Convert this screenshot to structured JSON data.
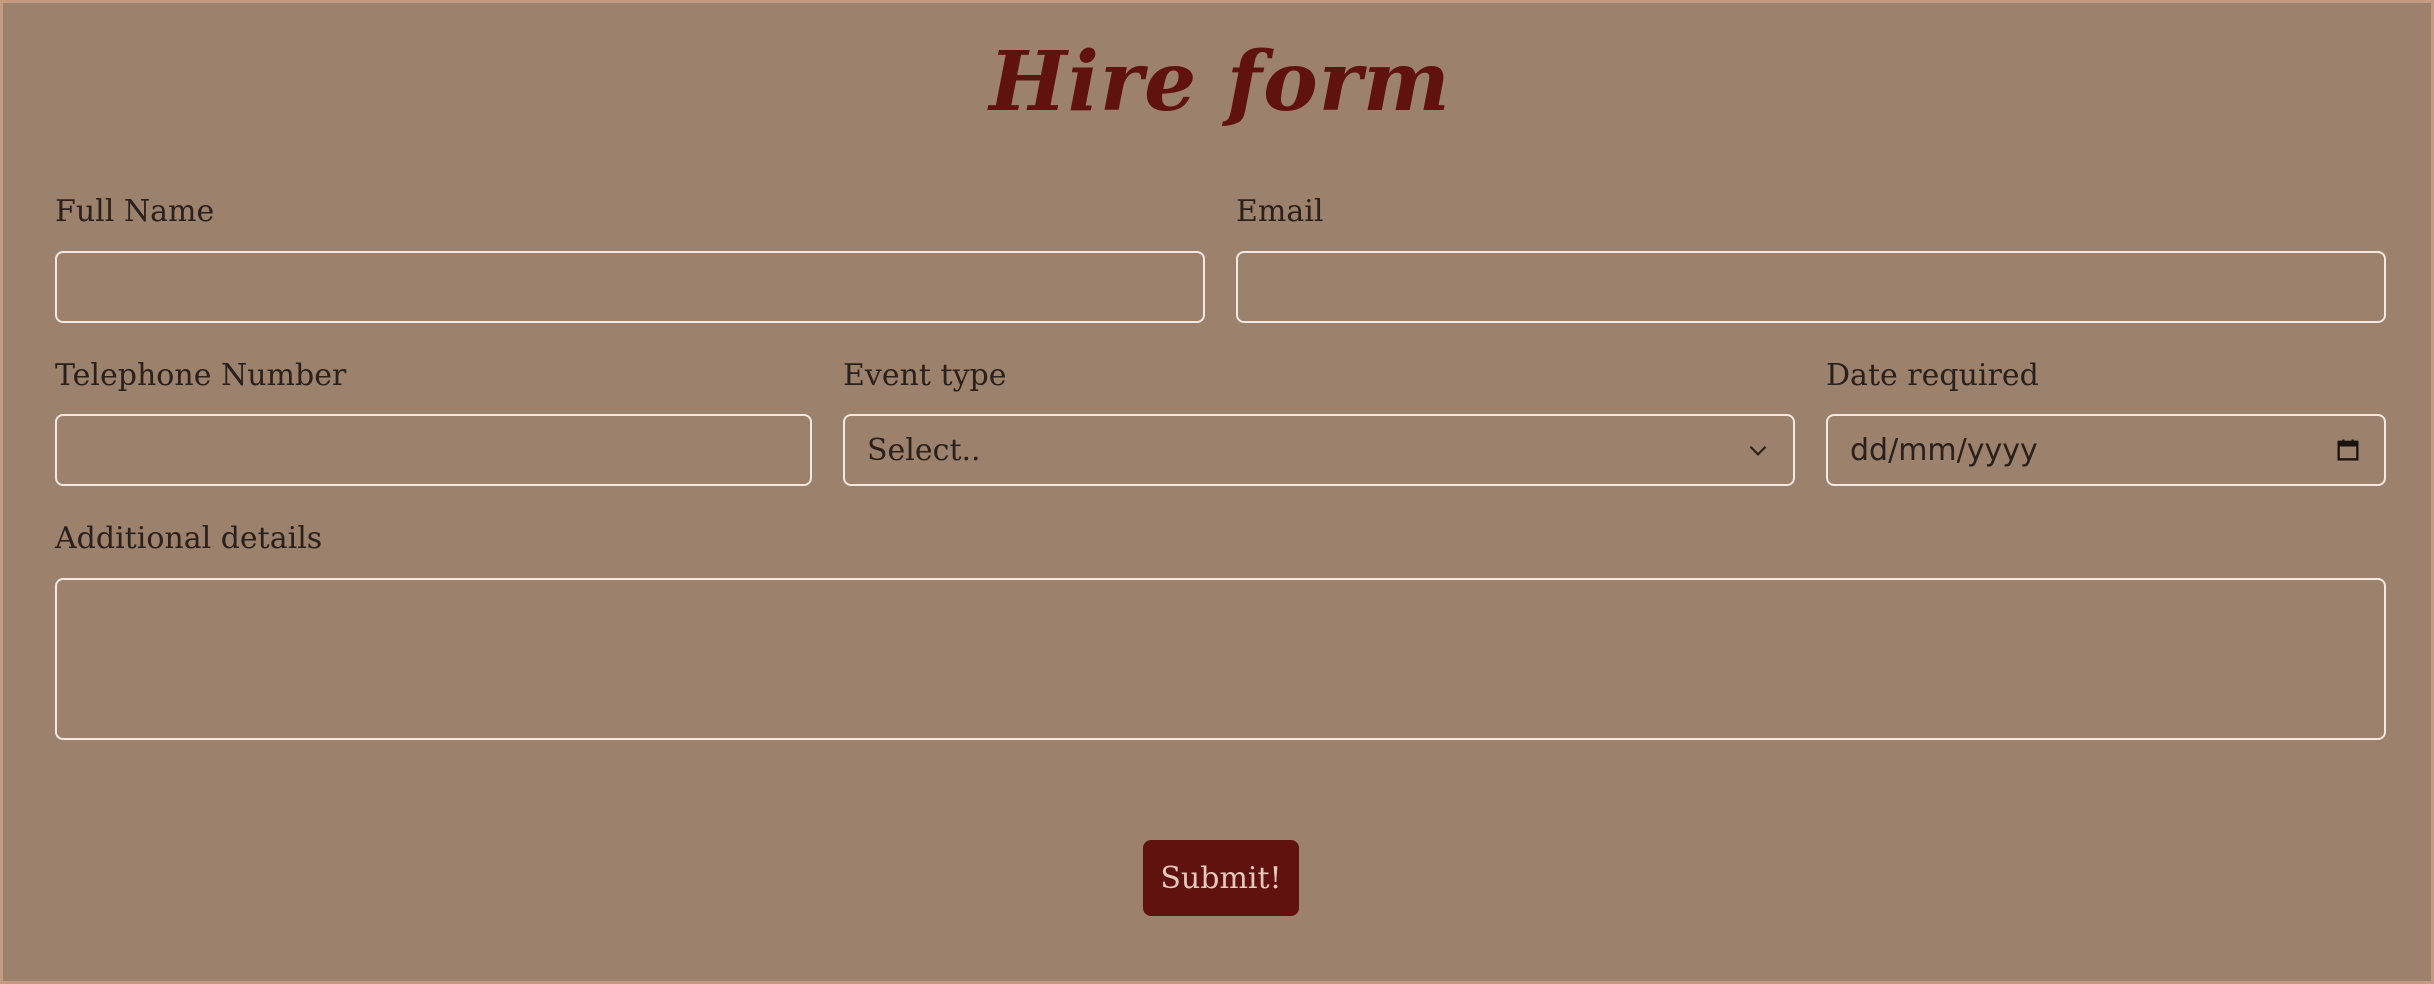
{
  "form": {
    "title": "Hire form",
    "full_name": {
      "label": "Full Name",
      "value": ""
    },
    "email": {
      "label": "Email",
      "value": ""
    },
    "telephone": {
      "label": "Telephone Number",
      "value": ""
    },
    "event_type": {
      "label": "Event type",
      "selected": "Select.."
    },
    "date_required": {
      "label": "Date required",
      "placeholder": "dd/mm/yyyy"
    },
    "additional_details": {
      "label": "Additional details",
      "value": ""
    },
    "submit_label": "Submit!"
  },
  "icons": {
    "event_type_dropdown": "chevron-down-icon",
    "date_picker": "calendar-icon"
  },
  "colors": {
    "background": "#9c826c",
    "title": "#5f120e",
    "field_border": "#f3e8e1",
    "button_background": "#5f120e",
    "button_text": "#e6c9b9",
    "text": "#2a201c"
  }
}
